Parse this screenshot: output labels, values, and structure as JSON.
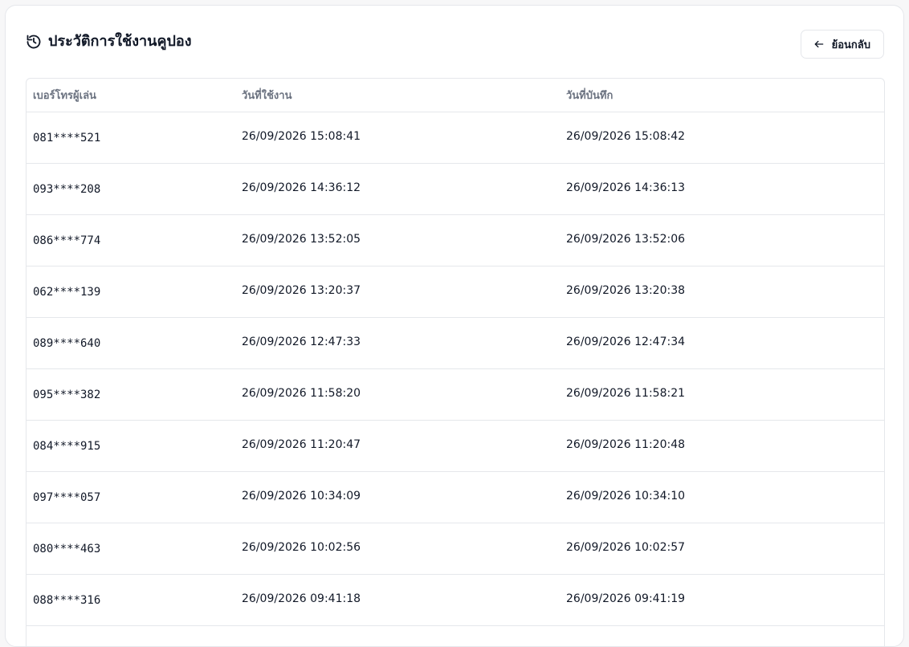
{
  "header": {
    "title": "ประวัติการใช้งานคูปอง",
    "title_icon": "history-icon",
    "back_label": "ย้อนกลับ",
    "back_icon": "arrow-left-icon"
  },
  "table": {
    "columns": [
      "เบอร์โทรผู้เล่น",
      "วันที่ใช้งาน",
      "วันที่บันทึก"
    ],
    "rows": [
      {
        "phone": "081****521",
        "used_at": "26/09/2026 15:08:41",
        "recorded_at": "26/09/2026 15:08:42"
      },
      {
        "phone": "093****208",
        "used_at": "26/09/2026 14:36:12",
        "recorded_at": "26/09/2026 14:36:13"
      },
      {
        "phone": "086****774",
        "used_at": "26/09/2026 13:52:05",
        "recorded_at": "26/09/2026 13:52:06"
      },
      {
        "phone": "062****139",
        "used_at": "26/09/2026 13:20:37",
        "recorded_at": "26/09/2026 13:20:38"
      },
      {
        "phone": "089****640",
        "used_at": "26/09/2026 12:47:33",
        "recorded_at": "26/09/2026 12:47:34"
      },
      {
        "phone": "095****382",
        "used_at": "26/09/2026 11:58:20",
        "recorded_at": "26/09/2026 11:58:21"
      },
      {
        "phone": "084****915",
        "used_at": "26/09/2026 11:20:47",
        "recorded_at": "26/09/2026 11:20:48"
      },
      {
        "phone": "097****057",
        "used_at": "26/09/2026 10:34:09",
        "recorded_at": "26/09/2026 10:34:10"
      },
      {
        "phone": "080****463",
        "used_at": "26/09/2026 10:02:56",
        "recorded_at": "26/09/2026 10:02:57"
      },
      {
        "phone": "088****316",
        "used_at": "26/09/2026 09:41:18",
        "recorded_at": "26/09/2026 09:41:19"
      }
    ]
  },
  "colors": {
    "border": "#e5e7eb",
    "header_text": "#6b7280",
    "text": "#111827",
    "background": "#ffffff"
  }
}
